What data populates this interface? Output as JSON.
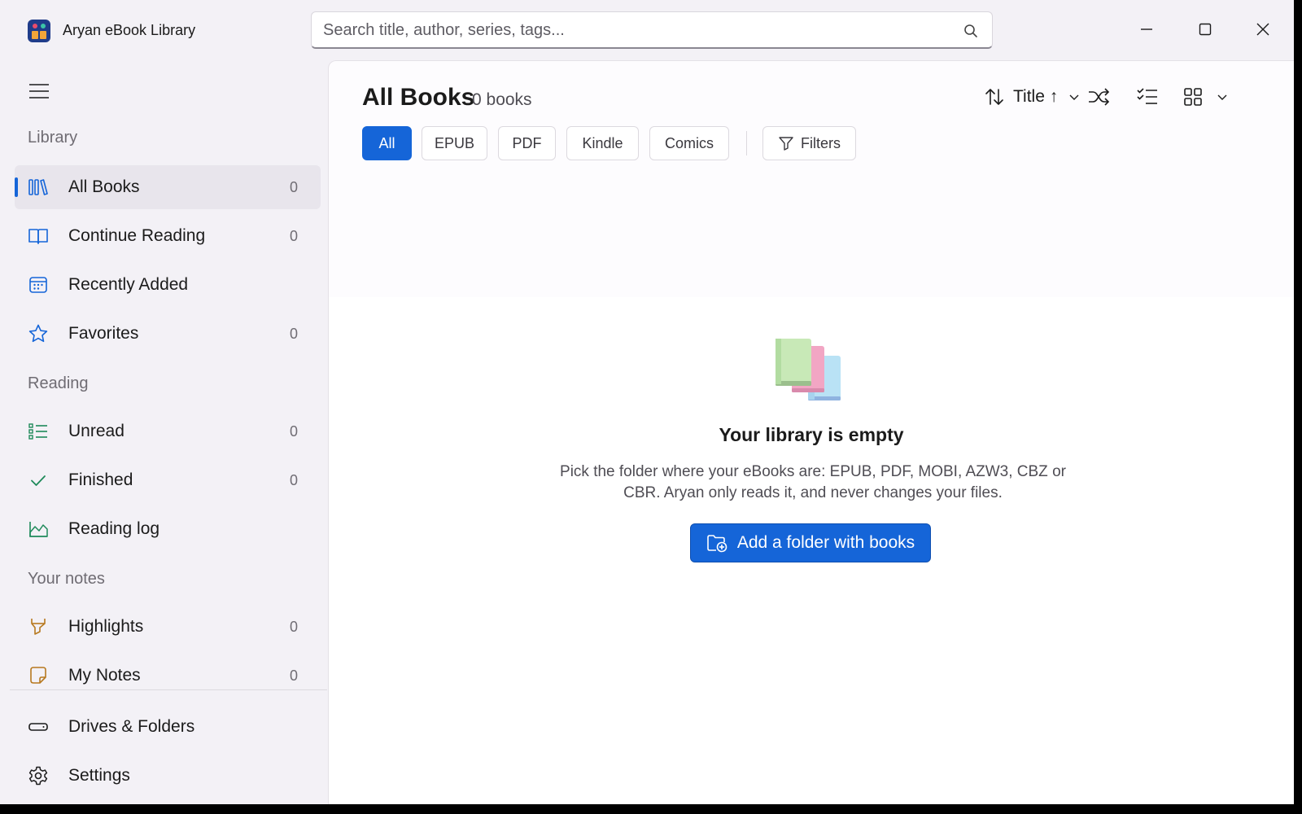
{
  "app": {
    "title": "Aryan eBook Library"
  },
  "search": {
    "placeholder": "Search title, author, series, tags..."
  },
  "sidebar": {
    "sections": {
      "library": "Library",
      "reading": "Reading",
      "notes": "Your notes"
    },
    "items": [
      {
        "label": "All Books",
        "count": "0",
        "icon": "library-icon"
      },
      {
        "label": "Continue Reading",
        "count": "0",
        "icon": "open-book-icon"
      },
      {
        "label": "Recently Added",
        "count": "",
        "icon": "calendar-icon"
      },
      {
        "label": "Favorites",
        "count": "0",
        "icon": "star-icon"
      },
      {
        "label": "Unread",
        "count": "0",
        "icon": "list-icon"
      },
      {
        "label": "Finished",
        "count": "0",
        "icon": "checkmark-icon"
      },
      {
        "label": "Reading log",
        "count": "",
        "icon": "chart-area-icon"
      },
      {
        "label": "Highlights",
        "count": "0",
        "icon": "highlighter-icon"
      },
      {
        "label": "My Notes",
        "count": "0",
        "icon": "sticky-note-icon"
      },
      {
        "label": "Drives & Folders",
        "count": "",
        "icon": "drive-icon"
      },
      {
        "label": "Settings",
        "count": "",
        "icon": "gear-icon"
      }
    ]
  },
  "main": {
    "title": "All Books",
    "count": "0 books",
    "sort_label": "Title ↑",
    "filters": [
      "All",
      "EPUB",
      "PDF",
      "Kindle",
      "Comics"
    ],
    "filters_button": "Filters",
    "empty": {
      "title": "Your library is empty",
      "description": "Pick the folder where your eBooks are: EPUB, PDF, MOBI, AZW3, CBZ or CBR. Aryan only reads it, and never changes your files.",
      "button": "Add a folder with books"
    }
  },
  "colors": {
    "accent": "#1565d8",
    "sidebar_bg": "#f3f1f6",
    "green_icon": "#1e8a5a",
    "amber_icon": "#b7791f"
  }
}
